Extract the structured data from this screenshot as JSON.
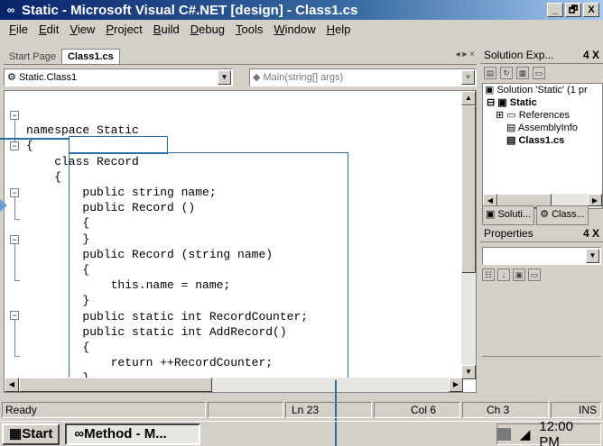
{
  "window": {
    "title": "Static - Microsoft Visual C#.NET [design] - Class1.cs",
    "minimize": "_",
    "maximize": "🗗",
    "close": "X"
  },
  "menu": [
    "File",
    "Edit",
    "View",
    "Project",
    "Build",
    "Debug",
    "Tools",
    "Window",
    "Help"
  ],
  "tabs": [
    {
      "label": "Start Page",
      "active": false
    },
    {
      "label": "Class1.cs",
      "active": true
    }
  ],
  "tab_controls": "◂ ▸ ×",
  "dropdowns": {
    "type": "Static.Class1",
    "member": "Main(string[] args)"
  },
  "code_lines": [
    "namespace Static",
    "{",
    "    class Record",
    "    {",
    "        public string name;",
    "        public Record ()",
    "        {",
    "        }",
    "        public Record (string name)",
    "        {",
    "            this.name = name;",
    "        }",
    "        public static int RecordCounter;",
    "        public static int AddRecord()",
    "        {",
    "            return ++RecordCounter;",
    "        }",
    "    }"
  ],
  "solution_explorer": {
    "title": "Solution Exp...",
    "pin": "4",
    "close": "X",
    "tree": [
      "Solution 'Static' (1 pr",
      "Static",
      "References",
      "AssemblyInfo",
      "Class1.cs"
    ],
    "tabs": [
      "Soluti...",
      "Class..."
    ]
  },
  "properties": {
    "title": "Properties",
    "pin": "4",
    "close": "X"
  },
  "status": {
    "ready": "Ready",
    "line": "Ln 23",
    "col": "Col 6",
    "ch": "Ch 3",
    "ins": "INS"
  },
  "taskbar": {
    "start": "Start",
    "task": "Method - M...",
    "clock": "12:00 PM"
  }
}
